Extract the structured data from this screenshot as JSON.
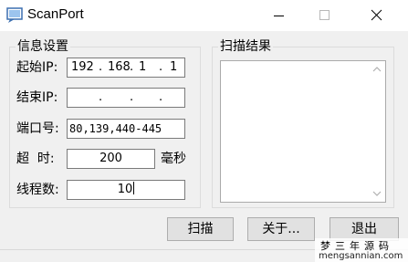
{
  "window": {
    "title": "ScanPort"
  },
  "info_group": {
    "title": "信息设置",
    "start_ip_label": "起始IP:",
    "start_ip": [
      "192",
      "168",
      "1",
      "1"
    ],
    "end_ip_label": "结束IP:",
    "end_ip": [
      "",
      "",
      "",
      ""
    ],
    "port_label": "端口号:",
    "port_value": "80,139,440-445",
    "timeout_label": "超  时:",
    "timeout_value": "200",
    "timeout_unit": "毫秒",
    "threads_label": "线程数:",
    "threads_value": "10"
  },
  "result_group": {
    "title": "扫描结果"
  },
  "buttons": {
    "scan": "扫描",
    "about": "关于...",
    "exit": "退出"
  },
  "watermark": {
    "line1": "梦三年源码",
    "line2": "mengsannian.com"
  },
  "icons": {
    "app": "scanport-app-icon",
    "minimize": "minimize-icon",
    "maximize": "maximize-icon",
    "close": "close-icon"
  }
}
